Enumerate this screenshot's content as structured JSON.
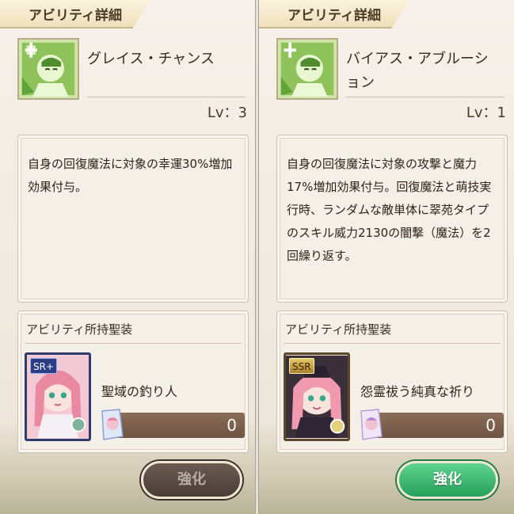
{
  "panels": [
    {
      "header": "アビリティ詳細",
      "ability_name": "グレイス・チャンス",
      "level": "Lv：3",
      "description": "自身の回復魔法に対象の幸運30%増加効果付与。",
      "equip_section_title": "アビリティ所持聖装",
      "equip": {
        "rarity": "SR+",
        "name": "聖域の釣り人",
        "count": "0"
      },
      "button_label": "強化",
      "button_state": "disabled"
    },
    {
      "header": "アビリティ詳細",
      "ability_name": "バイアス・アブルーション",
      "level": "Lv：1",
      "description": "自身の回復魔法に対象の攻撃と魔力17%増加効果付与。回復魔法と萌技実行時、ランダムな敵単体に翠苑タイプのスキル威力2130の闇撃（魔法）を2回繰り返す。",
      "equip_section_title": "アビリティ所持聖装",
      "equip": {
        "rarity": "SSR",
        "name": "怨霊祓う純真な祈り",
        "count": "0"
      },
      "button_label": "強化",
      "button_state": "active"
    }
  ],
  "colors": {
    "accent_green": "#26a05a",
    "bar_brown": "#6e5443"
  }
}
